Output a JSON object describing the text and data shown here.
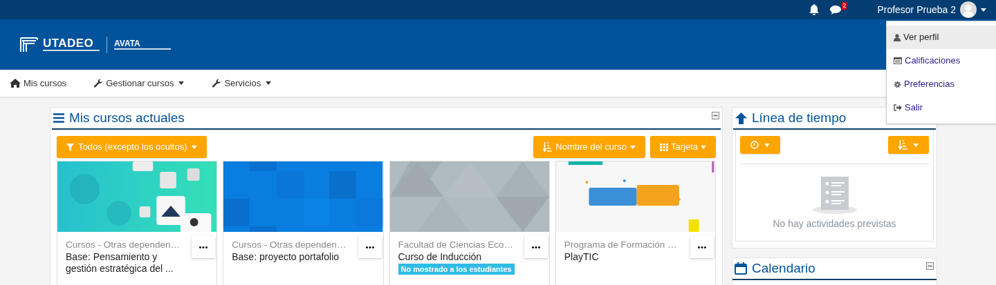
{
  "topbar": {
    "message_count": "2",
    "user_name": "Profesor Prueba 2"
  },
  "user_menu": [
    {
      "label": "Ver perfil",
      "selected": true
    },
    {
      "label": "Calificaciones",
      "selected": false
    },
    {
      "label": "Preferencias",
      "selected": false
    },
    {
      "label": "Salir",
      "selected": false
    }
  ],
  "header": {
    "logo_text": "UTADEO",
    "product_name": "AVATA"
  },
  "nav": [
    {
      "label": "Mis cursos",
      "has_menu": false
    },
    {
      "label": "Gestionar cursos",
      "has_menu": true
    },
    {
      "label": "Servicios",
      "has_menu": true
    }
  ],
  "courses_block": {
    "title": "Mis cursos actuales",
    "filter": "Todos (excepto los ocultos)",
    "sort": "Nombre del curso",
    "view": "Tarjeta",
    "courses": [
      {
        "category": "Cursos - Otras dependen…",
        "name": "Base: Pensamiento y gestión estratégica del ..."
      },
      {
        "category": "Cursos - Otras dependen…",
        "name": "Base: proyecto portafolio"
      },
      {
        "category": "Facultad de Ciencias Eco…",
        "name": "Curso de Inducción",
        "badge": "No mostrado a los estudiantes"
      },
      {
        "category": "Programa de Formación …",
        "name": "PlayTIC"
      }
    ]
  },
  "timeline": {
    "title": "Línea de tiempo",
    "empty_message": "No hay actividades previstas"
  },
  "calendar": {
    "title": "Calendario"
  }
}
